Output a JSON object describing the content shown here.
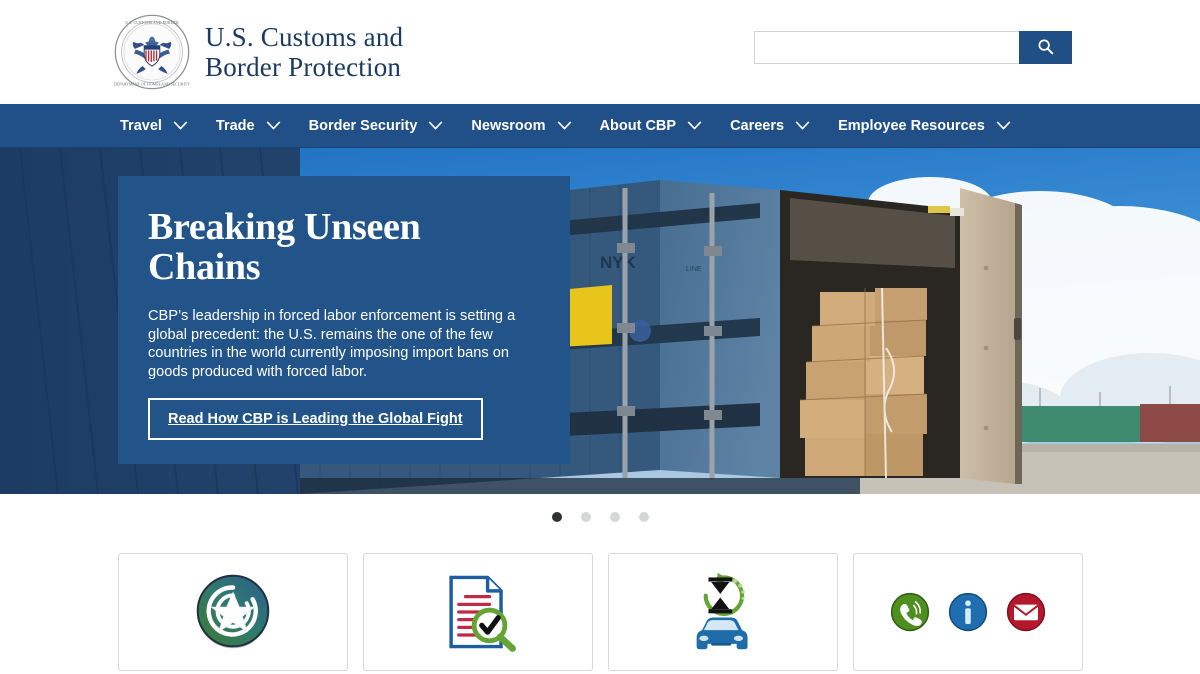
{
  "site": {
    "brand_title": "U.S. Customs and\nBorder Protection",
    "seal_icon": "cbp-seal-icon"
  },
  "search": {
    "value": "",
    "placeholder": "",
    "button_icon": "search-icon",
    "button_label": "Search"
  },
  "nav": {
    "items": [
      {
        "label": "Travel",
        "icon": "chevron-down-icon"
      },
      {
        "label": "Trade",
        "icon": "chevron-down-icon"
      },
      {
        "label": "Border Security",
        "icon": "chevron-down-icon"
      },
      {
        "label": "Newsroom",
        "icon": "chevron-down-icon"
      },
      {
        "label": "About CBP",
        "icon": "chevron-down-icon"
      },
      {
        "label": "Careers",
        "icon": "chevron-down-icon"
      },
      {
        "label": "Employee Resources",
        "icon": "chevron-down-icon"
      }
    ]
  },
  "hero": {
    "title": "Breaking Unseen Chains",
    "description": "CBP’s leadership in forced labor enforcement is setting a global precedent: the U.S. remains the one of the few countries in the world currently imposing import bans on goods produced with forced labor.",
    "cta_label": "Read How CBP is Leading the Global Fight",
    "background_description": "open blue shipping container loaded with cardboard boxes at a port under a cloudy blue sky",
    "panel_color": "#22548a"
  },
  "carousel": {
    "slides": 4,
    "active_index": 0,
    "dot_active_color": "#2f3032",
    "dot_inactive_color": "#d4d6d8"
  },
  "cards": [
    {
      "icon": "star-shield-badge-icon",
      "name": "trusted-traveler-card"
    },
    {
      "icon": "document-magnifier-check-icon",
      "name": "forms-card"
    },
    {
      "icon": "hourglass-car-wait-times-icon",
      "name": "border-wait-times-card"
    },
    {
      "icon": "contact-phone-info-mail-icon",
      "name": "contact-us-card"
    }
  ],
  "colors": {
    "nav_blue": "#215089",
    "brand_navy": "#1b3a63",
    "search_button": "#1f4f85",
    "card_border": "#d8d8d8"
  }
}
